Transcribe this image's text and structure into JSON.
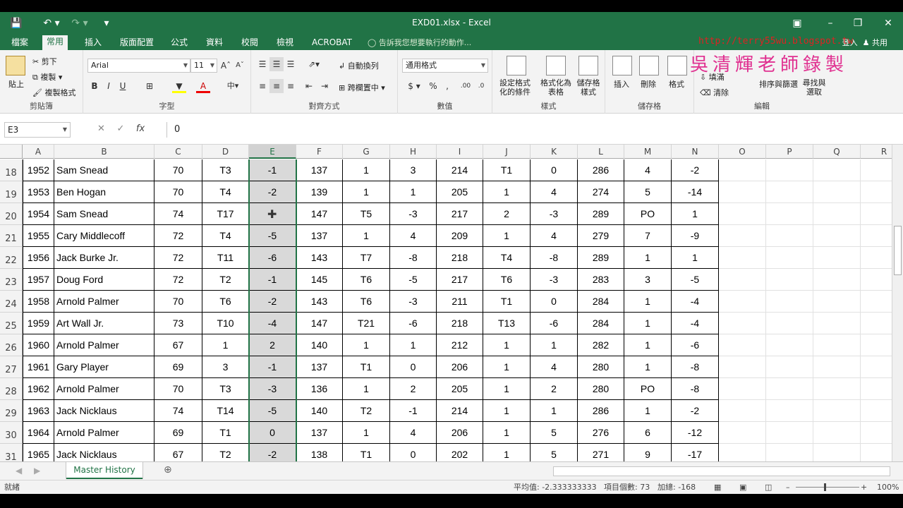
{
  "window": {
    "title": "EXD01.xlsx - Excel",
    "qat": [
      "save-icon",
      "undo-icon",
      "redo-icon",
      "customize-icon"
    ]
  },
  "tabs": [
    "檔案",
    "常用",
    "插入",
    "版面配置",
    "公式",
    "資料",
    "校閱",
    "檢視",
    "ACROBAT"
  ],
  "active_tab": "常用",
  "tell_me": "告訴我您想要執行的動作...",
  "user": {
    "signin": "登入",
    "share": "共用"
  },
  "watermark": {
    "url": "http://terry55wu.blogspot.tw",
    "name": "吳清輝老師錄製"
  },
  "ribbon": {
    "clipboard": {
      "label": "剪貼簿",
      "paste": "貼上",
      "cut": "剪下",
      "copy": "複製",
      "format_painter": "複製格式"
    },
    "font": {
      "label": "字型",
      "name": "Arial",
      "size": "11"
    },
    "alignment": {
      "label": "對齊方式",
      "wrap": "自動換列",
      "merge": "跨欄置中"
    },
    "number": {
      "label": "數值",
      "format": "通用格式"
    },
    "styles": {
      "label": "樣式",
      "cond": "設定格式化的條件",
      "table": "格式化為表格",
      "cell": "儲存格樣式"
    },
    "cells": {
      "label": "儲存格",
      "insert": "插入",
      "delete": "刪除",
      "format": "格式"
    },
    "editing": {
      "label": "編輯",
      "fill": "填滿",
      "clear": "清除",
      "sort": "排序與篩選",
      "find": "尋找與選取"
    }
  },
  "formula_bar": {
    "name_box": "E3",
    "formula": "0"
  },
  "columns": [
    "A",
    "B",
    "C",
    "D",
    "E",
    "F",
    "G",
    "H",
    "I",
    "J",
    "K",
    "L",
    "M",
    "N",
    "O",
    "P",
    "Q",
    "R"
  ],
  "selected_column": "E",
  "rows": [
    {
      "n": "18",
      "cells": [
        "1952",
        "Sam Snead",
        "70",
        "T3",
        "-1",
        "137",
        "1",
        "3",
        "214",
        "T1",
        "0",
        "286",
        "4",
        "-2"
      ]
    },
    {
      "n": "19",
      "cells": [
        "1953",
        "Ben Hogan",
        "70",
        "T4",
        "-2",
        "139",
        "1",
        "1",
        "205",
        "1",
        "4",
        "274",
        "5",
        "-14"
      ]
    },
    {
      "n": "20",
      "cells": [
        "1954",
        "Sam Snead",
        "74",
        "T17",
        "",
        "147",
        "T5",
        "-3",
        "217",
        "2",
        "-3",
        "289",
        "PO",
        "1"
      ]
    },
    {
      "n": "21",
      "cells": [
        "1955",
        "Cary Middlecoff",
        "72",
        "T4",
        "-5",
        "137",
        "1",
        "4",
        "209",
        "1",
        "4",
        "279",
        "7",
        "-9"
      ]
    },
    {
      "n": "22",
      "cells": [
        "1956",
        "Jack Burke Jr.",
        "72",
        "T11",
        "-6",
        "143",
        "T7",
        "-8",
        "218",
        "T4",
        "-8",
        "289",
        "1",
        "1"
      ]
    },
    {
      "n": "23",
      "cells": [
        "1957",
        "Doug Ford",
        "72",
        "T2",
        "-1",
        "145",
        "T6",
        "-5",
        "217",
        "T6",
        "-3",
        "283",
        "3",
        "-5"
      ]
    },
    {
      "n": "24",
      "cells": [
        "1958",
        "Arnold Palmer",
        "70",
        "T6",
        "-2",
        "143",
        "T6",
        "-3",
        "211",
        "T1",
        "0",
        "284",
        "1",
        "-4"
      ]
    },
    {
      "n": "25",
      "cells": [
        "1959",
        "Art Wall Jr.",
        "73",
        "T10",
        "-4",
        "147",
        "T21",
        "-6",
        "218",
        "T13",
        "-6",
        "284",
        "1",
        "-4"
      ]
    },
    {
      "n": "26",
      "cells": [
        "1960",
        "Arnold Palmer",
        "67",
        "1",
        "2",
        "140",
        "1",
        "1",
        "212",
        "1",
        "1",
        "282",
        "1",
        "-6"
      ]
    },
    {
      "n": "27",
      "cells": [
        "1961",
        "Gary Player",
        "69",
        "3",
        "-1",
        "137",
        "T1",
        "0",
        "206",
        "1",
        "4",
        "280",
        "1",
        "-8"
      ]
    },
    {
      "n": "28",
      "cells": [
        "1962",
        "Arnold Palmer",
        "70",
        "T3",
        "-3",
        "136",
        "1",
        "2",
        "205",
        "1",
        "2",
        "280",
        "PO",
        "-8"
      ]
    },
    {
      "n": "29",
      "cells": [
        "1963",
        "Jack Nicklaus",
        "74",
        "T14",
        "-5",
        "140",
        "T2",
        "-1",
        "214",
        "1",
        "1",
        "286",
        "1",
        "-2"
      ]
    },
    {
      "n": "30",
      "cells": [
        "1964",
        "Arnold Palmer",
        "69",
        "T1",
        "0",
        "137",
        "1",
        "4",
        "206",
        "1",
        "5",
        "276",
        "6",
        "-12"
      ]
    },
    {
      "n": "31",
      "cells": [
        "1965",
        "Jack Nicklaus",
        "67",
        "T2",
        "-2",
        "138",
        "T1",
        "0",
        "202",
        "1",
        "5",
        "271",
        "9",
        "-17"
      ]
    }
  ],
  "sheet_tab": "Master History",
  "status": {
    "ready": "就緒",
    "average": "平均值: -2.333333333",
    "count": "項目個數: 73",
    "sum": "加總: -168",
    "zoom": "100%"
  }
}
